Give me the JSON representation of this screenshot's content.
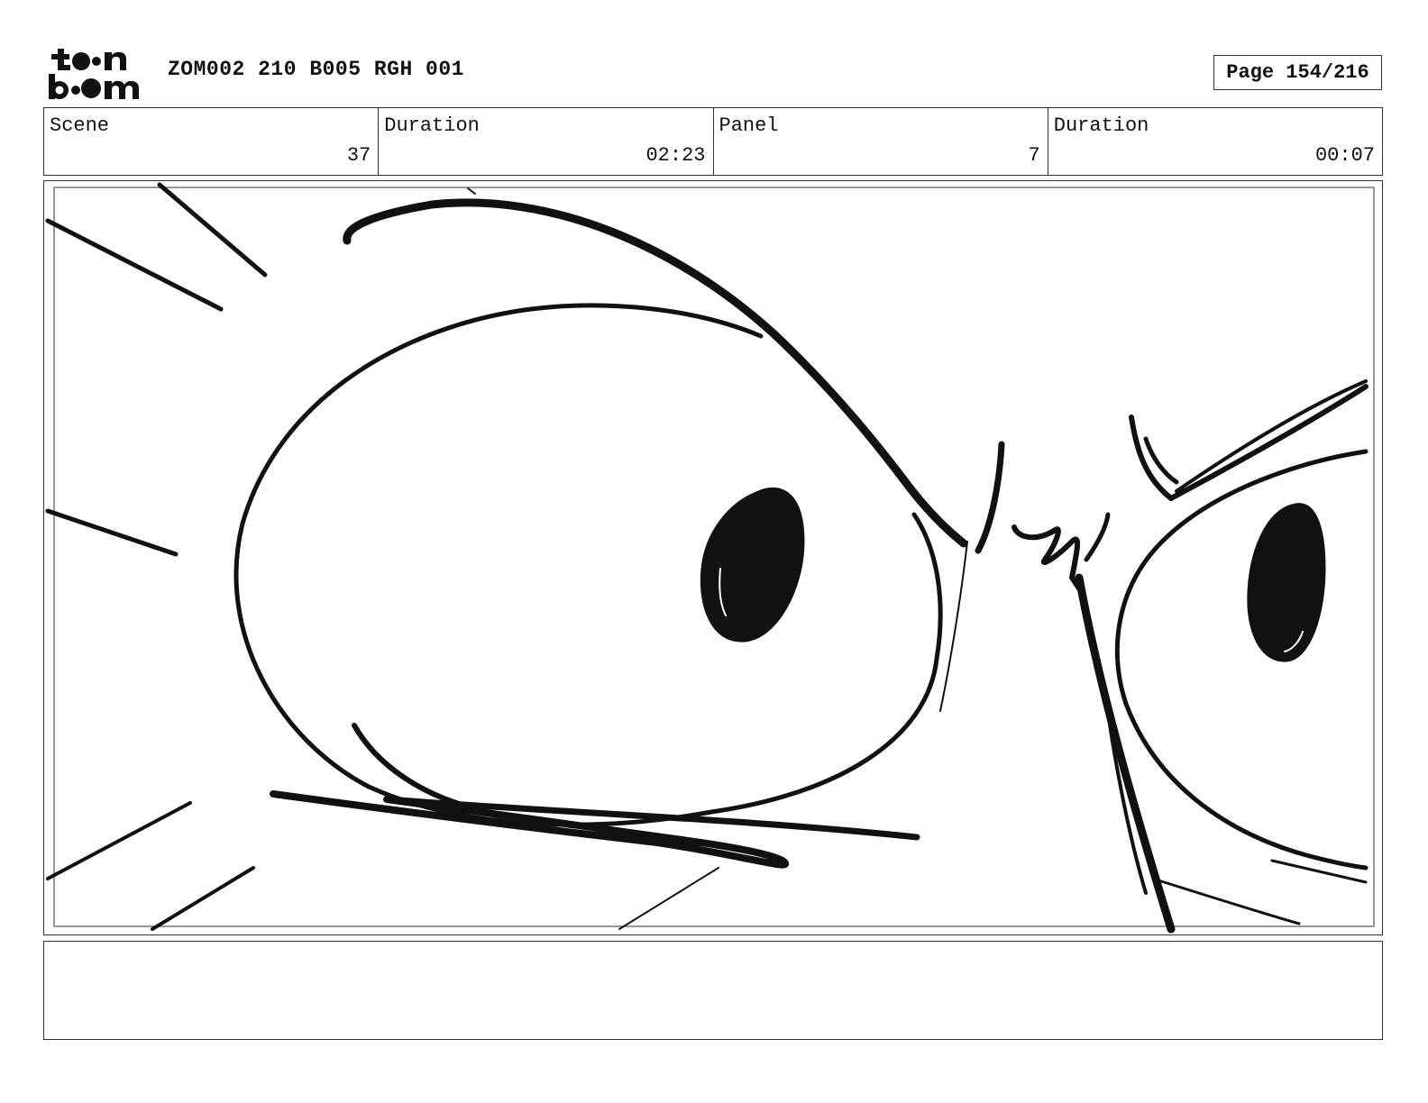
{
  "header": {
    "logo_icon": "toon-boom-logo-icon",
    "doc_title": "ZOM002 210 B005 RGH 001",
    "page_label": "Page 154/216"
  },
  "info": {
    "scene_label": "Scene",
    "scene_value": "37",
    "scene_duration_label": "Duration",
    "scene_duration_value": "02:23",
    "panel_label": "Panel",
    "panel_value": "7",
    "panel_duration_label": "Duration",
    "panel_duration_value": "00:07"
  },
  "panel": {
    "drawing_icon": "storyboard-sketch-eyes"
  },
  "notes": {
    "text": ""
  }
}
